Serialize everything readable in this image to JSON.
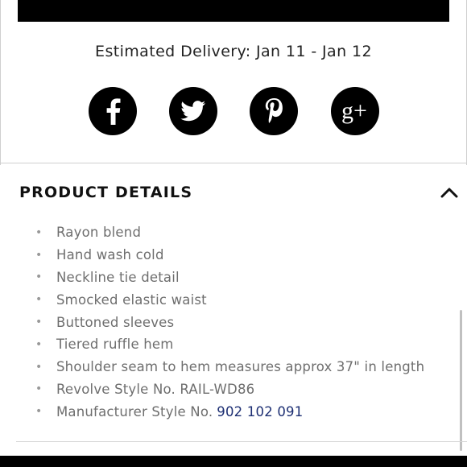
{
  "delivery": {
    "text": "Estimated Delivery: Jan 11 - Jan 12"
  },
  "social": [
    {
      "name": "facebook",
      "icon": "facebook-icon"
    },
    {
      "name": "twitter",
      "icon": "twitter-bird-icon"
    },
    {
      "name": "pinterest",
      "icon": "pinterest-icon"
    },
    {
      "name": "google-plus",
      "icon": "google-plus-icon",
      "text": "g+"
    }
  ],
  "product_details": {
    "title": "PRODUCT DETAILS",
    "toggle_icon": "chevron-up-icon",
    "items": [
      "Rayon blend",
      "Hand wash cold",
      "Neckline tie detail",
      "Smocked elastic waist",
      "Buttoned sleeves",
      "Tiered ruffle hem",
      "Shoulder seam to hem measures approx 37\" in length",
      "Revolve Style No. RAIL-WD86"
    ],
    "manufacturer_label": "Manufacturer Style No.",
    "manufacturer_number": "902 102 091",
    "bullet": "•"
  },
  "colors": {
    "text": "#1a1a1a",
    "muted": "#6e6e6e",
    "link": "#1d2f73",
    "icon_bg": "#000000"
  }
}
